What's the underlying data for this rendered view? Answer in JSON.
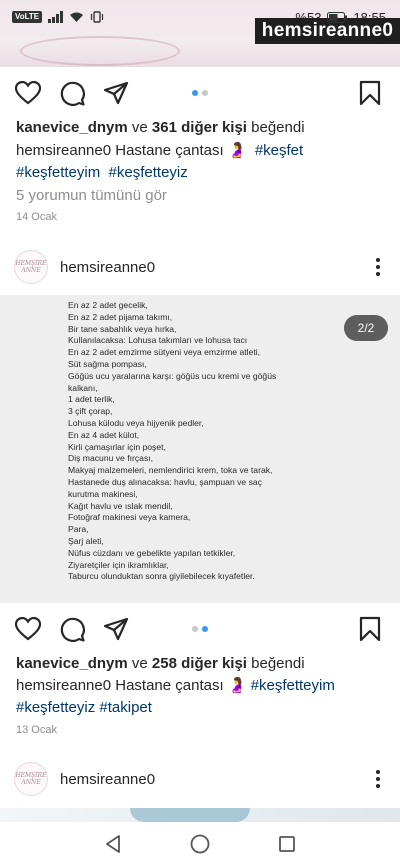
{
  "status_bar": {
    "volte": "VoLTE",
    "battery_percent": "%53",
    "time": "18:55"
  },
  "top_image": {
    "watermark": "hemsireanne0"
  },
  "post1": {
    "carousel_dots": 2,
    "carousel_active": 0,
    "likes": {
      "user": "kanevice_dnym",
      "connector": "ve",
      "others": "361 diğer kişi",
      "suffix": "beğendi"
    },
    "caption": {
      "user": "hemsireanne0",
      "text": "Hastane çantası 🤰",
      "tag1": "#keşfet",
      "tag2": "#keşfetteyim",
      "tag3": "#keşfetteyiz"
    },
    "comments_link": "5 yorumun tümünü gör",
    "date": "14 Ocak"
  },
  "post2": {
    "username": "hemsireanne0",
    "avatar_text_top": "HEMŞİRE",
    "avatar_text_bottom": "ANNE",
    "counter": "2/2",
    "list_items": [
      "En az 2 adet gecelik,",
      "En az 2 adet pijama takımı,",
      "Bir tane sabahlık veya hırka,",
      "Kullanılacaksa: Lohusa takımları ve lohusa tacı",
      "En az 2 adet emzirme sütyeni veya emzirme atleti,",
      "Süt sağma pompası,",
      "Göğüs ucu yaralarına karşı: göğüs ucu kremi ve göğüs",
      "kalkanı,",
      "1 adet terlik,",
      "3 çift çorap,",
      "Lohusa külodu veya hijyenik pedler,",
      "En az 4 adet külot,",
      "Kirli çamaşırlar için poşet,",
      "Diş macunu ve fırçası,",
      "Makyaj malzemeleri, nemlendirici krem, toka ve tarak,",
      "Hastanede duş alınacaksa: havlu, şampuan ve saç",
      "kurutma makinesi,",
      "Kağıt havlu ve ıslak mendil,",
      "Fotoğraf makinesi veya kamera,",
      "Para,",
      "Şarj aleti,",
      "Nüfus cüzdanı ve gebelikte yapılan tetkikler,",
      "Ziyaretçiler için ikramlıklar,",
      "Taburcu olunduktan sonra giyilebilecek kıyafetler."
    ],
    "carousel_dots": 2,
    "carousel_active": 1,
    "likes": {
      "user": "kanevice_dnym",
      "connector": "ve",
      "others": "258 diğer kişi",
      "suffix": "beğendi"
    },
    "caption": {
      "user": "hemsireanne0",
      "text": "Hastane çantası 🤰",
      "tag1": "#keşfetteyim",
      "tag2": "#keşfetteyiz",
      "tag3": "#takipet"
    },
    "date": "13 Ocak"
  },
  "post3": {
    "username": "hemsireanne0",
    "avatar_text_top": "HEMŞİRE",
    "avatar_text_bottom": "ANNE"
  },
  "colors": {
    "link": "#00376b",
    "dot_active": "#3897f0",
    "dot_inactive": "#c8c8c8",
    "muted": "#8e8e8e"
  }
}
